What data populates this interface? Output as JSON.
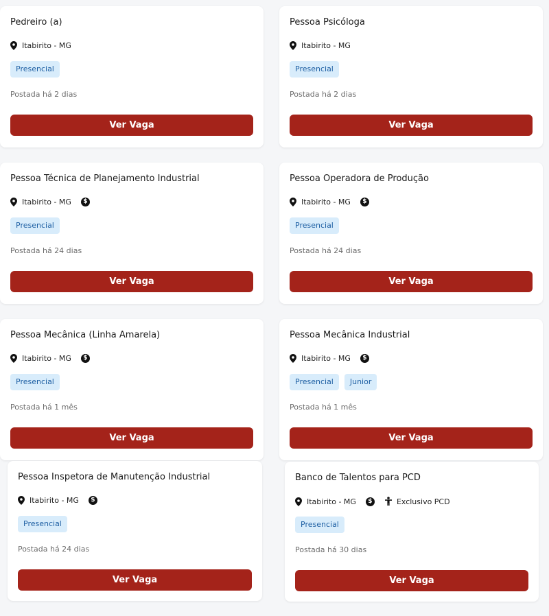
{
  "accent_color": "#a4231a",
  "tag_bg_color": "#d8ecfb",
  "jobs": [
    {
      "title": "Pedreiro (a)",
      "location": "Itabirito - MG",
      "salary_icon": false,
      "pcd_label": "",
      "tags": [
        "Presencial"
      ],
      "posted": "Postada há 2 dias",
      "button": "Ver Vaga"
    },
    {
      "title": "Pessoa Psicóloga",
      "location": "Itabirito - MG",
      "salary_icon": false,
      "pcd_label": "",
      "tags": [
        "Presencial"
      ],
      "posted": "Postada há 2 dias",
      "button": "Ver Vaga"
    },
    {
      "title": "Pessoa Técnica de Planejamento Industrial",
      "location": "Itabirito - MG",
      "salary_icon": true,
      "pcd_label": "",
      "tags": [
        "Presencial"
      ],
      "posted": "Postada há 24 dias",
      "button": "Ver Vaga"
    },
    {
      "title": "Pessoa Operadora de Produção",
      "location": "Itabirito - MG",
      "salary_icon": true,
      "pcd_label": "",
      "tags": [
        "Presencial"
      ],
      "posted": "Postada há 24 dias",
      "button": "Ver Vaga"
    },
    {
      "title": "Pessoa Mecânica (Linha Amarela)",
      "location": "Itabirito - MG",
      "salary_icon": true,
      "pcd_label": "",
      "tags": [
        "Presencial"
      ],
      "posted": "Postada há 1 mês",
      "button": "Ver Vaga"
    },
    {
      "title": "Pessoa Mecânica Industrial",
      "location": "Itabirito - MG",
      "salary_icon": true,
      "pcd_label": "",
      "tags": [
        "Presencial",
        "Junior"
      ],
      "posted": "Postada há 1 mês",
      "button": "Ver Vaga"
    },
    {
      "title": "Pessoa Inspetora de Manutenção Industrial",
      "location": "Itabirito - MG",
      "salary_icon": true,
      "pcd_label": "",
      "tags": [
        "Presencial"
      ],
      "posted": "Postada há 24 dias",
      "button": "Ver Vaga"
    },
    {
      "title": "Banco de Talentos para PCD",
      "location": "Itabirito - MG",
      "salary_icon": true,
      "pcd_label": "Exclusivo PCD",
      "tags": [
        "Presencial"
      ],
      "posted": "Postada há 30 dias",
      "button": "Ver Vaga"
    }
  ]
}
